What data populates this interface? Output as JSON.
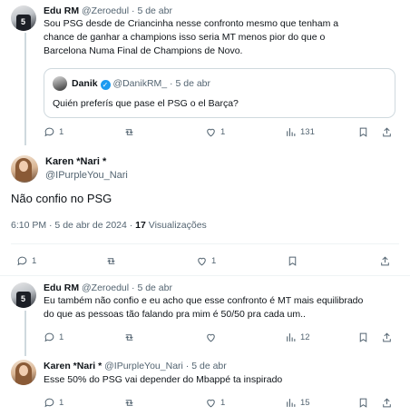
{
  "reply_top": {
    "name": "Edu RM",
    "handle": "@Zeroedul",
    "sep": "·",
    "date": "5 de abr",
    "text_lines": [
      "Sou PSG desde de Criancinha nesse confronto mesmo que tenham a",
      "chance de ganhar a champions isso seria MT menos pior do que o",
      "Barcelona Numa Final de Champions de Novo."
    ],
    "quote": {
      "name": "Danik",
      "handle": "@DanikRM_",
      "sep": "·",
      "date": "5 de abr",
      "text": "Quién preferís que pase el PSG o el Barça?"
    },
    "actions": {
      "replies": "1",
      "retweets": "",
      "likes": "1",
      "views": "131"
    }
  },
  "main": {
    "name": "Karen *Nari *",
    "handle": "@IPurpleYou_Nari",
    "text": "Não confio no PSG",
    "time": "6:10 PM · 5 de abr de 2024 ·",
    "views_count": "17",
    "views_label": "Visualizações",
    "actions": {
      "replies": "1",
      "retweets": "",
      "likes": "1"
    }
  },
  "reply2": {
    "name": "Edu RM",
    "handle": "@Zeroedul",
    "sep": "·",
    "date": "5 de abr",
    "text_lines": [
      "Eu também não confio e eu acho que esse confronto é MT mais equilibrado",
      "do que as pessoas tão falando pra mim é 50/50 pra cada um.."
    ],
    "actions": {
      "replies": "1",
      "retweets": "",
      "likes": "",
      "views": "12"
    }
  },
  "reply3": {
    "name": "Karen *Nari *",
    "handle": "@IPurpleYou_Nari",
    "sep": "·",
    "date": "5 de abr",
    "text": "Esse 50% do PSG vai depender do Mbappé ta inspirado",
    "actions": {
      "replies": "1",
      "retweets": "",
      "likes": "1",
      "views": "15"
    }
  },
  "avatar_jersey_number": "5",
  "icons": [
    "reply-icon",
    "retweet-icon",
    "like-icon",
    "views-icon",
    "bookmark-icon",
    "share-icon",
    "verified-badge-icon"
  ],
  "colors": {
    "muted": "#536471",
    "border": "#cfd9de",
    "verified": "#1d9bf0"
  }
}
